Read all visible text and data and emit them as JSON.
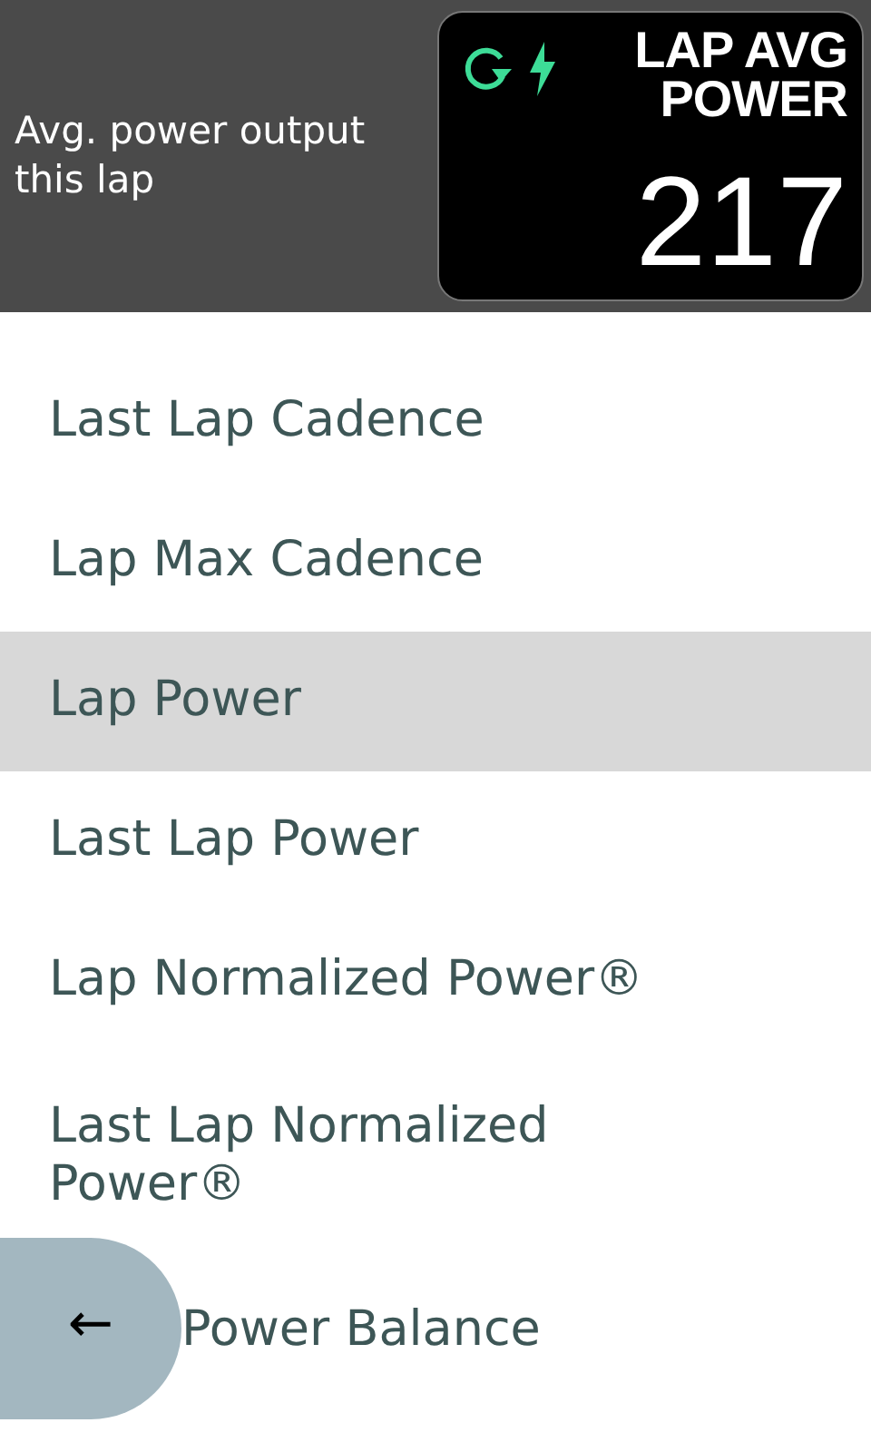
{
  "header": {
    "description": "Avg. power output this lap",
    "preview": {
      "title_lines": [
        "LAP AVG",
        "POWER"
      ],
      "value": "217"
    }
  },
  "items": [
    {
      "label": "Last Lap Cadence",
      "selected": false,
      "kind": "full"
    },
    {
      "label": "Lap Max Cadence",
      "selected": false,
      "kind": "full"
    },
    {
      "label": "Lap Power",
      "selected": true,
      "kind": "full"
    },
    {
      "label": "Last Lap Power",
      "selected": false,
      "kind": "full"
    },
    {
      "label": "Lap Normalized Power®",
      "selected": false,
      "kind": "full"
    },
    {
      "label": "Last Lap Normalized Power®",
      "selected": false,
      "kind": "full"
    },
    {
      "label": "Power Balance",
      "selected": false,
      "kind": "covered"
    }
  ],
  "back_button": {
    "symbol": "←"
  }
}
